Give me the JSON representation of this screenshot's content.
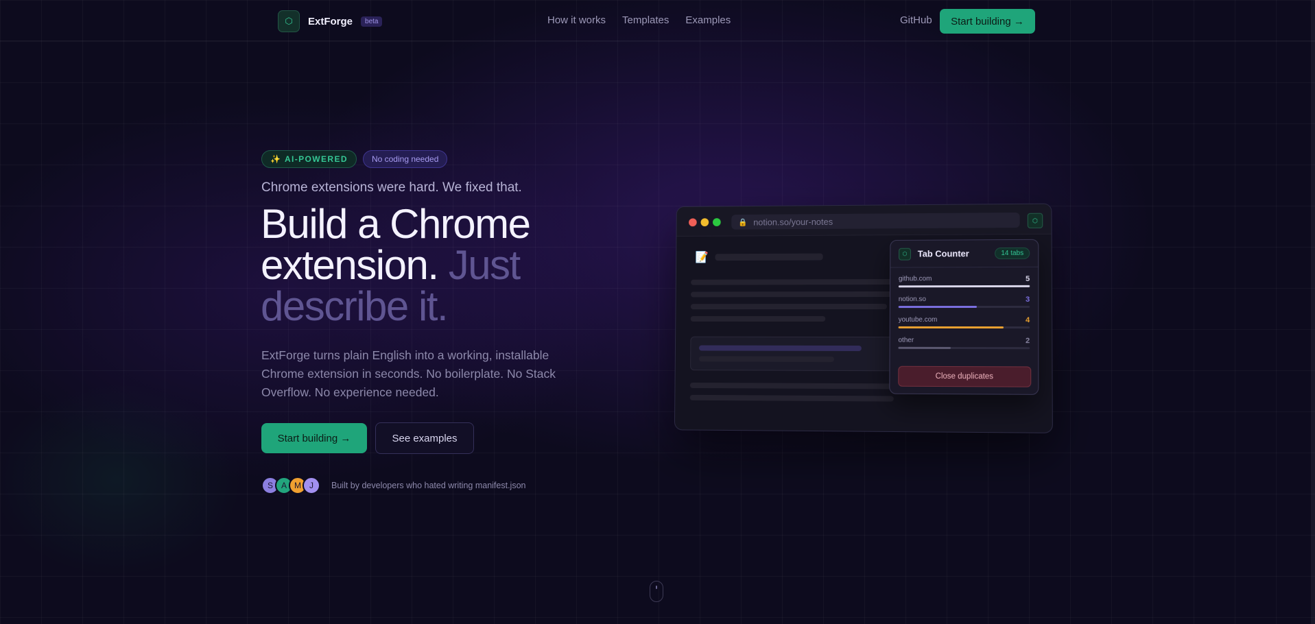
{
  "nav": {
    "logo_glyph": "⬡",
    "brand": "ExtForge",
    "beta": "beta",
    "links": [
      "How it works",
      "Templates",
      "Examples"
    ],
    "github": "GitHub",
    "cta": "Start building →"
  },
  "hero": {
    "badge_ai_icon": "✨",
    "badge_ai": "AI-POWERED",
    "badge_no_code": "No coding needed",
    "tagline": "Chrome extensions were hard. We fixed that.",
    "headline_main": "Build a Chrome extension.",
    "headline_muted": "Just describe it.",
    "description": "ExtForge turns plain English into a working, installable Chrome extension in seconds. No boilerplate. No Stack Overflow. No experience needed.",
    "primary_cta": "Start building →",
    "secondary_cta": "See examples",
    "avatars": [
      {
        "letter": "S",
        "color": "#8b7fe0"
      },
      {
        "letter": "A",
        "color": "#22a57d"
      },
      {
        "letter": "M",
        "color": "#f0a030"
      },
      {
        "letter": "J",
        "color": "#a290f0"
      }
    ],
    "social_text": "Built by developers who hated writing manifest.json"
  },
  "mockup": {
    "url": "notion.so/your-notes",
    "lock_icon": "🔒",
    "doc_icon": "📝",
    "ext_glyph": "⬡",
    "popup": {
      "title": "Tab Counter",
      "count": "14 tabs",
      "rows": [
        {
          "domain": "github.com",
          "count": "5",
          "fraction": 1.0,
          "color": "#d9d6ea"
        },
        {
          "domain": "notion.so",
          "count": "3",
          "fraction": 0.6,
          "color": "#7b6fe0"
        },
        {
          "domain": "youtube.com",
          "count": "4",
          "fraction": 0.8,
          "color": "#e9a030"
        },
        {
          "domain": "other",
          "count": "2",
          "fraction": 0.4,
          "color": "#5b5870"
        }
      ],
      "button": "Close duplicates"
    }
  },
  "colors": {
    "accent_green": "#1fa57a",
    "accent_purple": "#7b6fe0",
    "background": "#0d0b1e"
  }
}
